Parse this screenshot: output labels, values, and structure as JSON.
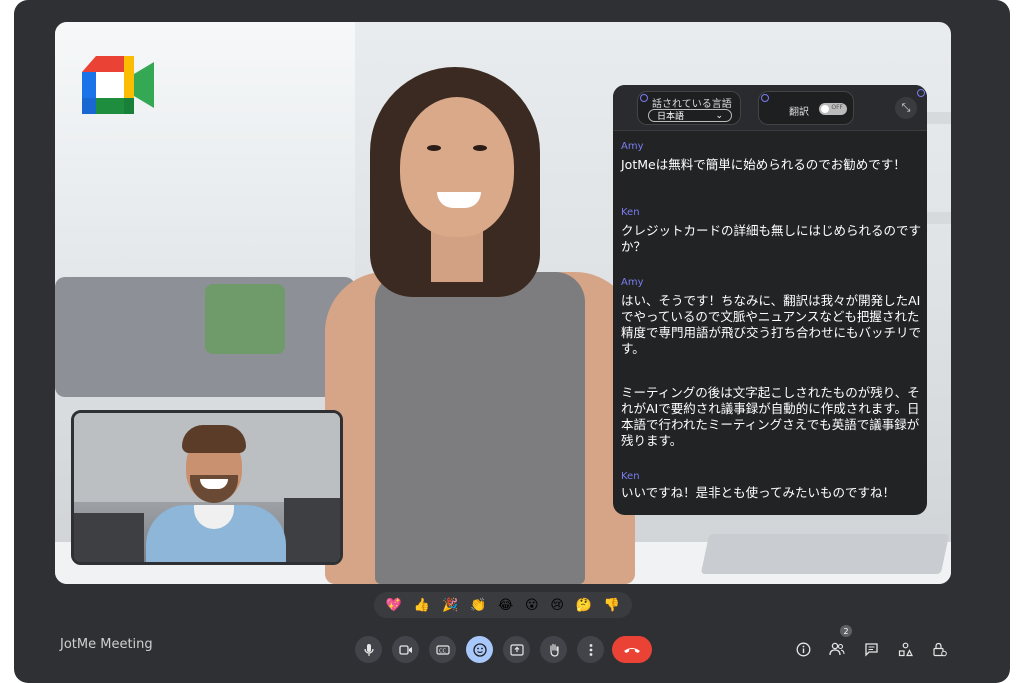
{
  "meeting": {
    "title": "JotMe Meeting"
  },
  "panel": {
    "spoken_language_label": "話されている言語",
    "spoken_language_value": "日本語",
    "translation_label": "翻訳",
    "toggle_state": "OFF",
    "messages": [
      {
        "speaker": "Amy",
        "text": "JotMeは無料で簡単に始められるのでお勧めです！"
      },
      {
        "speaker": "Ken",
        "text": "クレジットカードの詳細も無しにはじめられるのですか？"
      },
      {
        "speaker": "Amy",
        "text": "はい、そうです！ちなみに、翻訳は我々が開発したAIでやっているので文脈やニュアンスなども把握された精度で専門用語が飛び交う打ち合わせにもバッチリです。"
      },
      {
        "speaker": "",
        "text": "ミーティングの後は文字起こしされたものが残り、それがAIで要約され議事録が自動的に作成されます。日本語で行われたミーティングさえでも英語で議事録が残ります。"
      },
      {
        "speaker": "Ken",
        "text": "いいですね！是非とも使ってみたいものですね！"
      }
    ]
  },
  "reactions": [
    "💖",
    "👍",
    "🎉",
    "👏",
    "😂",
    "😮",
    "😢",
    "🤔",
    "👎"
  ],
  "participants_count": "2",
  "icons": {
    "mic": "microphone-icon",
    "camera": "camera-icon",
    "captions": "captions-icon",
    "emoji": "emoji-icon",
    "present": "present-screen-icon",
    "hand": "raise-hand-icon",
    "more": "more-options-icon",
    "end": "end-call-icon",
    "info": "info-icon",
    "people": "people-icon",
    "chat": "chat-icon",
    "activities": "activities-icon",
    "host": "host-controls-icon"
  },
  "colors": {
    "frame": "#2f3034",
    "panel": "#222325",
    "speaker_accent": "#7b7cf0",
    "end_call": "#ea4335",
    "active_control": "#a8c7fa"
  }
}
